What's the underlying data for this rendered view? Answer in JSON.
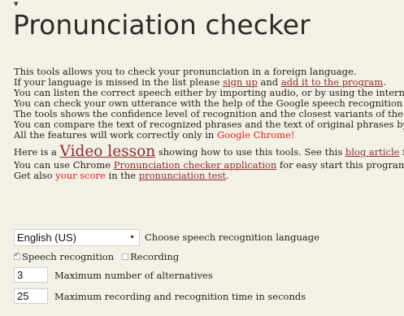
{
  "header": {
    "title": "Pronunciation checker"
  },
  "intro": {
    "line1": "This tools allows you to check your pronunciation in a foreign language.",
    "line2_pre": "If your language is missed in the list please ",
    "line2_link1": "sign up",
    "line2_mid": " and ",
    "line2_link2": "add it to the program",
    "line2_post": ".",
    "line3": "You can listen the correct speech either by importing audio, or by using the interna",
    "line4": "You can check your own utterance with the help of the Google speech recognition",
    "line5": "The tools shows the confidence level of recognition and the closest variants of the",
    "line6": "You can compare the text of recognized phrases and the text of original phrases by",
    "line7_pre": "All the features will work correctly only in ",
    "line7_highlight": "Google Chrome!",
    "lesson_pre": "Here is a ",
    "lesson_link": "Video lesson",
    "lesson_mid": " showing how to use this tools. See this ",
    "lesson_link2": "blog article",
    "lesson_post": " fo",
    "chrome_pre": "You can use Chrome ",
    "chrome_link": "Pronunciation checker application",
    "chrome_post": " for easy start this program",
    "score_pre": "Get also ",
    "score_highlight": "your score",
    "score_mid": " in the ",
    "score_link": "pronunciation test",
    "score_post": "."
  },
  "controls": {
    "language_value": "English (US)",
    "language_label": "Choose speech recognition language",
    "speech_recognition_label": "Speech recognition",
    "speech_recognition_checked": true,
    "recording_label": "Recording",
    "recording_checked": false,
    "alternatives_value": "3",
    "alternatives_label": "Maximum number of alternatives",
    "max_time_value": "25",
    "max_time_label": "Maximum recording and recognition time in seconds"
  },
  "icons": {
    "top_arrow": "down-arrow-icon",
    "select_arrow": "dropdown-arrow-icon",
    "checkbox_check": "check-icon"
  },
  "colors": {
    "background": "#f3f0e5",
    "link": "#8b2e2e",
    "highlight": "#e0201b"
  }
}
